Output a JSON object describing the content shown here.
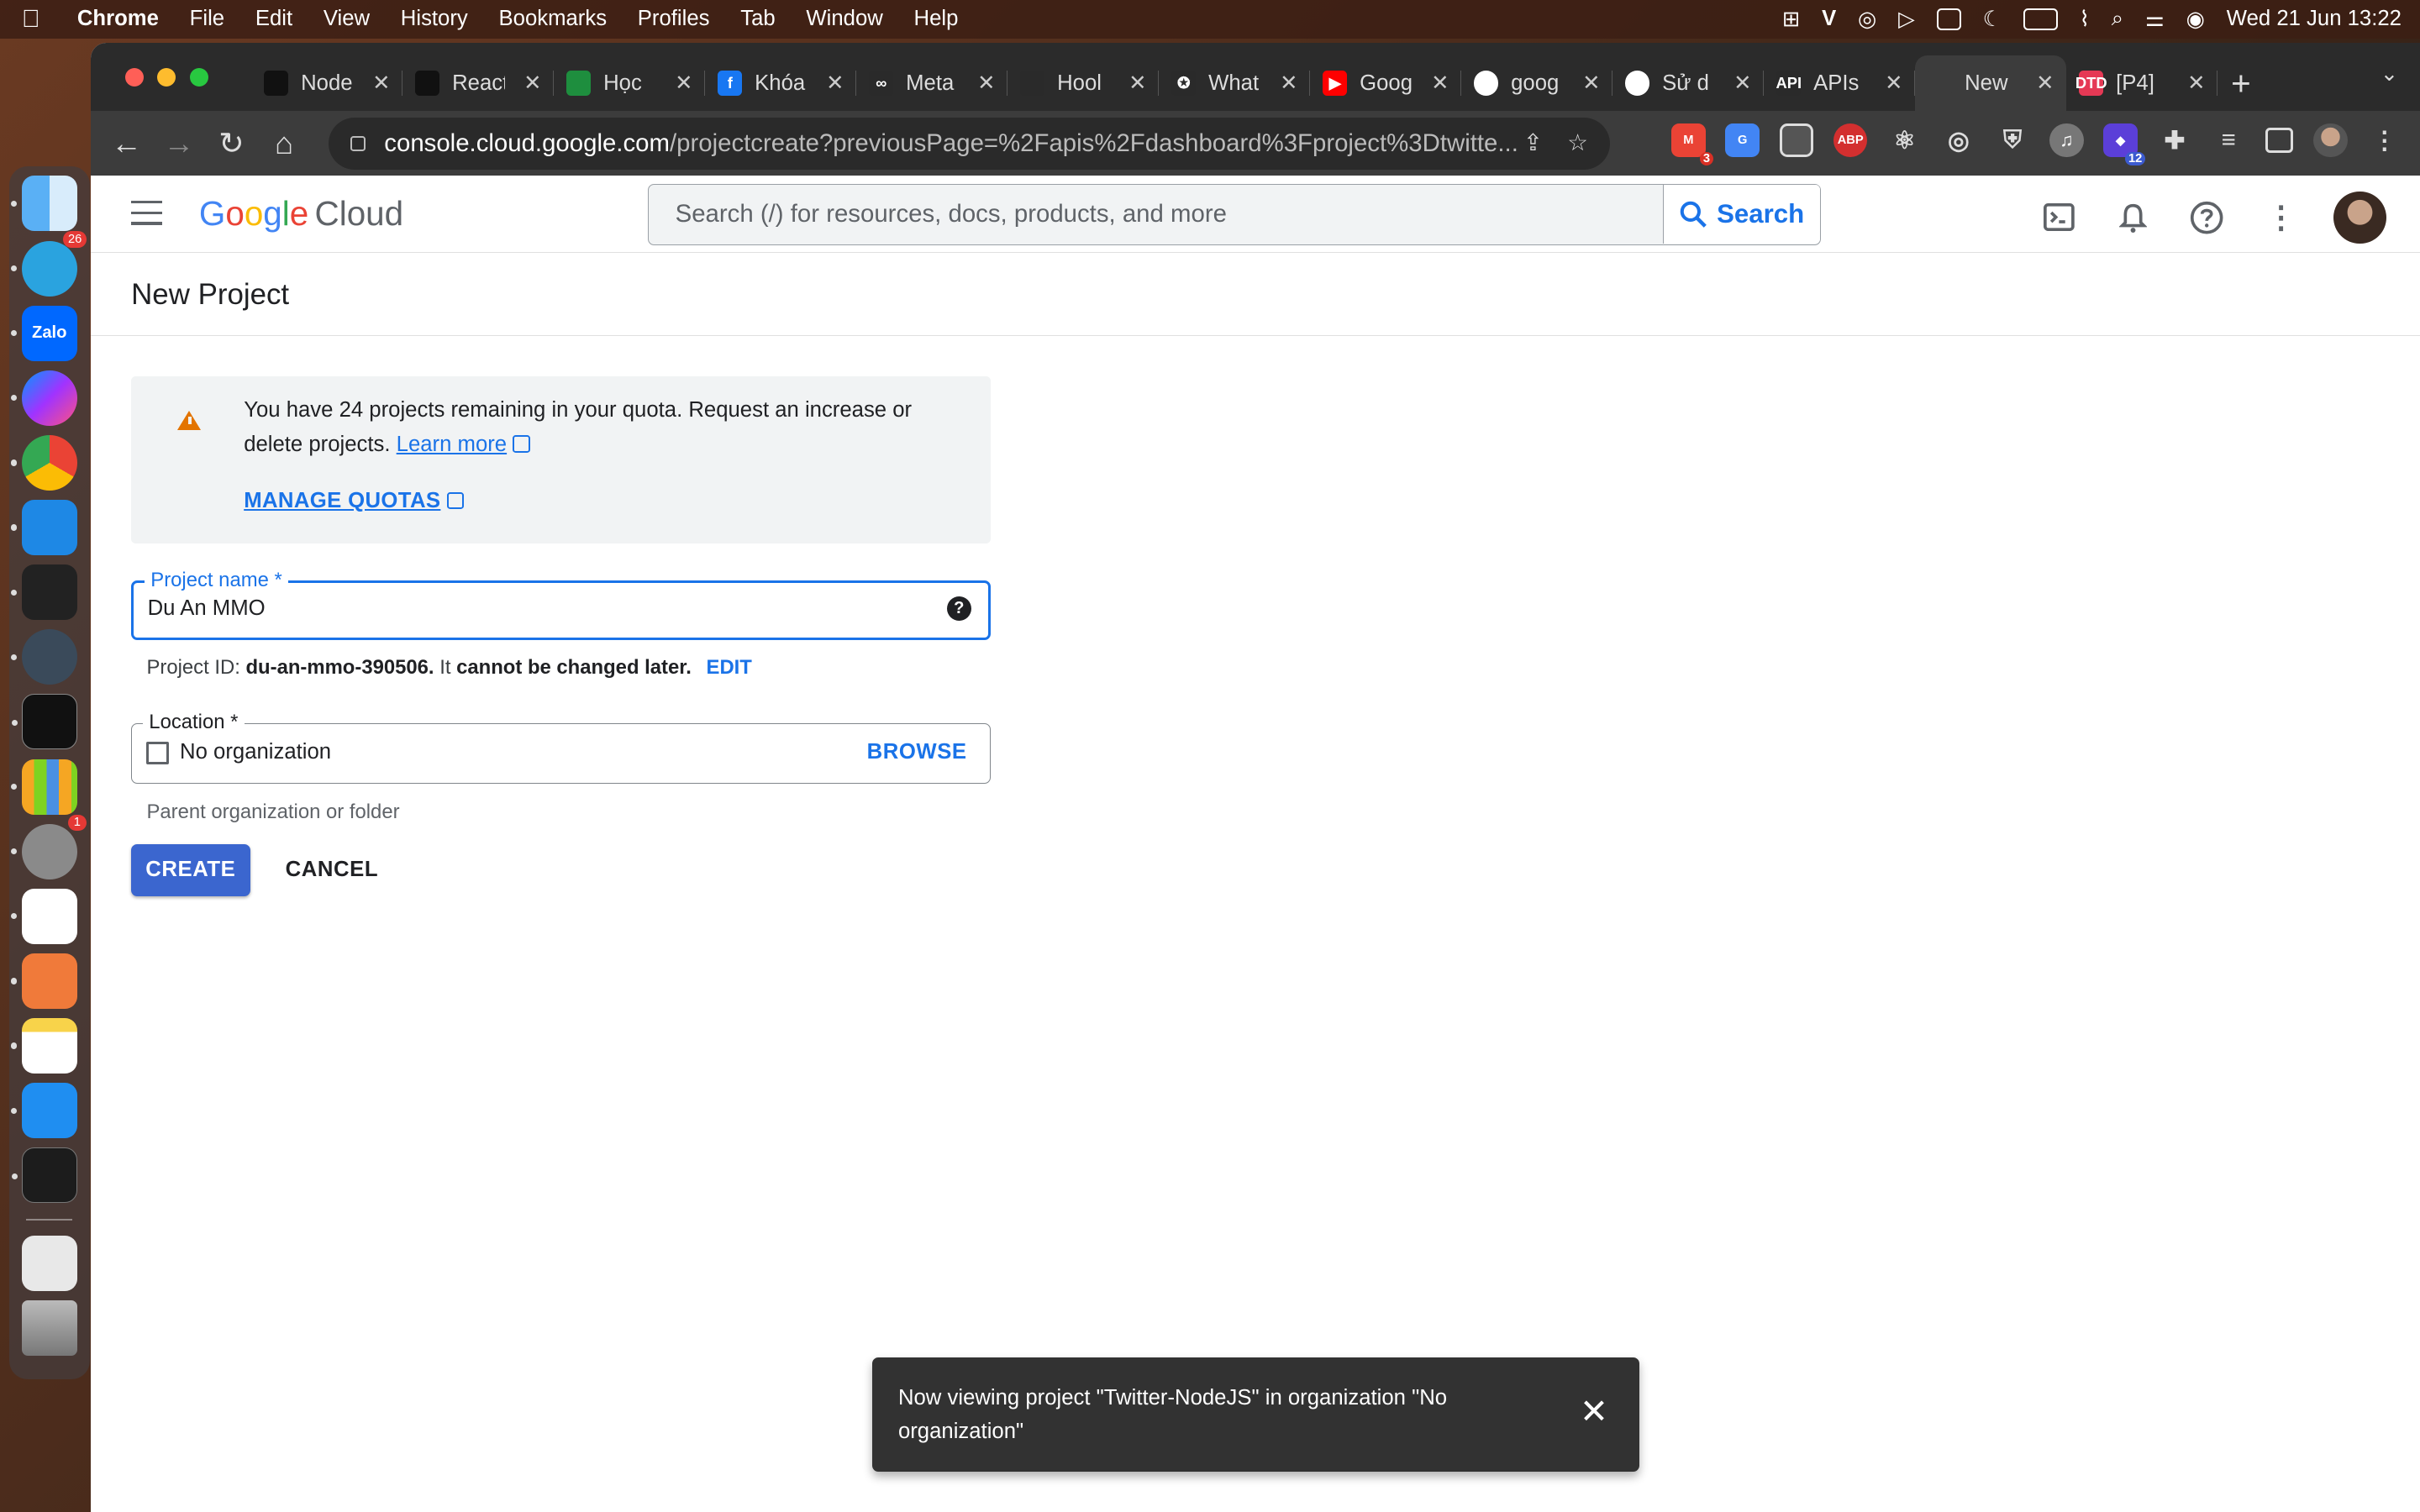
{
  "menubar": {
    "app": "Chrome",
    "items": [
      "File",
      "Edit",
      "View",
      "History",
      "Bookmarks",
      "Profiles",
      "Tab",
      "Window",
      "Help"
    ],
    "clock": "Wed 21 Jun  13:22"
  },
  "dock": {
    "telegram_badge": "26",
    "zalo_label": "Zalo",
    "settings_badge": "1"
  },
  "tabs": [
    {
      "label": "Node",
      "fav_color": "#111111",
      "fav": ""
    },
    {
      "label": "React",
      "fav_color": "#111111",
      "fav": ""
    },
    {
      "label": "Học",
      "fav_color": "#1e8e3e",
      "fav": ""
    },
    {
      "label": "Khóa",
      "fav_color": "#1877f2",
      "fav": "f"
    },
    {
      "label": "Meta",
      "fav_color": "#2a2a2a",
      "fav": "∞"
    },
    {
      "label": "Hool",
      "fav_color": "#2a2a2a",
      "fav": ""
    },
    {
      "label": "What",
      "fav_color": "#2a2a2a",
      "fav": "✪"
    },
    {
      "label": "Goog",
      "fav_color": "#ff0000",
      "fav": "▶"
    },
    {
      "label": "goog",
      "fav_color": "#ffffff",
      "fav": ""
    },
    {
      "label": "Sử d",
      "fav_color": "#ffffff",
      "fav": ""
    },
    {
      "label": "APIs",
      "fav_color": "#2a2a2a",
      "fav": "API"
    },
    {
      "label": "New",
      "fav_color": "#3c3c3c",
      "fav": ""
    },
    {
      "label": "[P4]",
      "fav_color": "#e53955",
      "fav": "DTD"
    }
  ],
  "omnibox": {
    "host": "console.cloud.google.com",
    "path": "/projectcreate?previousPage=%2Fapis%2Fdashboard%3Fproject%3Dtwitte..."
  },
  "extensions": {
    "gmail_badge": "3",
    "abp_label": "ABP",
    "ext12_badge": "12"
  },
  "header": {
    "logo_google": [
      "G",
      "o",
      "o",
      "g",
      "l",
      "e"
    ],
    "logo_cloud": "Cloud",
    "search_placeholder": "Search (/) for resources, docs, products, and more",
    "search_button": "Search"
  },
  "page": {
    "title": "New Project",
    "quota": {
      "text": "You have 24 projects remaining in your quota. Request an increase or delete projects.",
      "learn_more": "Learn more",
      "manage_quotas": "MANAGE QUOTAS"
    },
    "project_name": {
      "label": "Project name *",
      "value": "Du An MMO",
      "help": "?"
    },
    "project_id": {
      "prefix": "Project ID:",
      "id": "du-an-mmo-390506.",
      "middle": "It",
      "bold": "cannot be changed later.",
      "edit": "EDIT"
    },
    "location": {
      "label": "Location *",
      "value": "No organization",
      "browse": "BROWSE",
      "helper": "Parent organization or folder"
    },
    "buttons": {
      "create": "CREATE",
      "cancel": "CANCEL"
    }
  },
  "snackbar": {
    "message": "Now viewing project \"Twitter-NodeJS\" in organization \"No organization\"",
    "close": "✕"
  }
}
